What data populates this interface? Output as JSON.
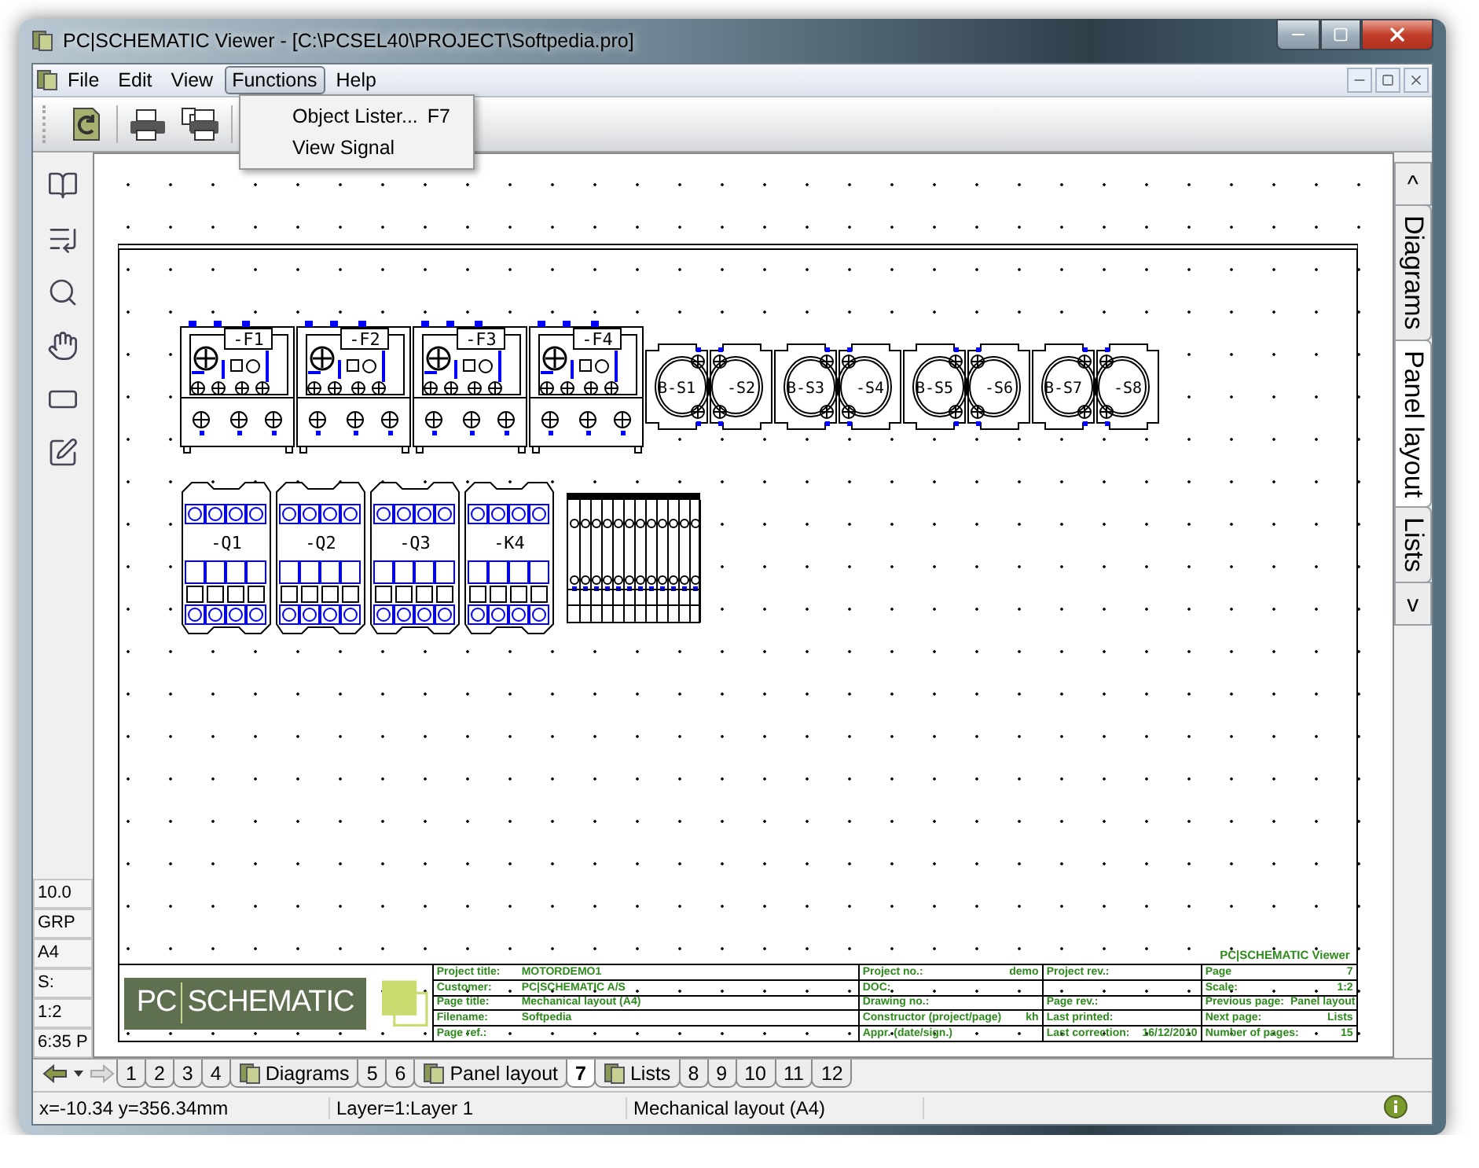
{
  "window": {
    "title": "PC|SCHEMATIC Viewer - [C:\\PCSEL40\\PROJECT\\Softpedia.pro]"
  },
  "menu": [
    {
      "label": "File",
      "selected": false
    },
    {
      "label": "Edit",
      "selected": false
    },
    {
      "label": "View",
      "selected": false
    },
    {
      "label": "Functions",
      "selected": true
    },
    {
      "label": "Help",
      "selected": false
    }
  ],
  "dropdown": [
    {
      "label": "Object Lister...",
      "shortcut": "F7"
    },
    {
      "label": "View Signal"
    }
  ],
  "left_status": [
    "10.0",
    "GRP",
    "A4",
    "S:",
    "1:2",
    "6:35 P"
  ],
  "canvas": {
    "row_1": [
      {
        "kind": "breaker",
        "label": "-F1"
      },
      {
        "kind": "breaker",
        "label": "-F2"
      },
      {
        "kind": "breaker",
        "label": "-F3"
      },
      {
        "kind": "breaker",
        "label": "-F4"
      },
      {
        "kind": "switch",
        "label": "B-S1"
      },
      {
        "kind": "switch",
        "label": "-S2"
      },
      {
        "kind": "switch",
        "label": "B-S3"
      },
      {
        "kind": "switch",
        "label": "-S4"
      },
      {
        "kind": "switch",
        "label": "B-S5"
      },
      {
        "kind": "switch",
        "label": "-S6"
      },
      {
        "kind": "switch",
        "label": "B-S7"
      },
      {
        "kind": "switch",
        "label": "-S8"
      }
    ],
    "row_2": [
      {
        "kind": "contactor",
        "label": "-Q1"
      },
      {
        "kind": "contactor",
        "label": "-Q2"
      },
      {
        "kind": "contactor",
        "label": "-Q3"
      },
      {
        "kind": "contactor",
        "label": "-K4"
      },
      {
        "kind": "terminal_strip"
      }
    ],
    "viewer_label": "PC|SCHEMATIC Viewer",
    "logo": {
      "left": "PC",
      "right": "SCHEMATIC"
    },
    "title_block": [
      [
        {
          "kind": "field",
          "label": "Project title:",
          "value": "MOTORDEMO1"
        },
        {
          "kind": "field",
          "label": "Customer:",
          "value": "PC|SCHEMATIC A/S"
        },
        {
          "kind": "field",
          "label": "Page title:",
          "value": "Mechanical layout (A4)"
        },
        {
          "kind": "field",
          "label": "Filename:",
          "value": "Softpedia"
        },
        {
          "kind": "field",
          "label": "Page ref.:"
        }
      ],
      [
        {
          "kind": "field",
          "label": "Project no.:",
          "value": "demo"
        },
        {
          "kind": "field",
          "label": "DOC:"
        },
        {
          "kind": "field",
          "label": "Drawing no.:"
        },
        {
          "kind": "field",
          "label": "Constructor (project/page)",
          "value": "kh"
        },
        {
          "kind": "field",
          "label": "Appr. (date/sign.)"
        }
      ],
      [
        {
          "kind": "field",
          "label": "Project rev.:"
        },
        {
          "kind": "blank"
        },
        {
          "kind": "field",
          "label": "Page rev.:"
        },
        {
          "kind": "field",
          "label": "Last printed:"
        },
        {
          "kind": "field",
          "label": "Last correction:",
          "value": "16/12/2010"
        }
      ],
      [
        {
          "kind": "field",
          "label": "Page",
          "value": "7"
        },
        {
          "kind": "field",
          "label": "Scale:",
          "value": "1:2"
        },
        {
          "kind": "field",
          "label": "Previous page:",
          "value": "Panel layout"
        },
        {
          "kind": "field",
          "label": "Next page:",
          "value": "Lists"
        },
        {
          "kind": "field",
          "label": "Number of pages:",
          "value": "15"
        }
      ]
    ]
  },
  "side_tabs": [
    {
      "kind": "arrow",
      "label": "^",
      "selected": false
    },
    {
      "kind": "tab",
      "label": "Diagrams",
      "selected": false
    },
    {
      "kind": "tab",
      "label": "Panel layout",
      "selected": true
    },
    {
      "kind": "tab",
      "label": "Lists",
      "selected": false
    },
    {
      "kind": "arrow",
      "label": "v",
      "selected": false
    }
  ],
  "page_tabs": [
    {
      "kind": "page",
      "label": "1",
      "selected": false
    },
    {
      "kind": "page",
      "label": "2",
      "selected": false
    },
    {
      "kind": "page",
      "label": "3",
      "selected": false
    },
    {
      "kind": "page",
      "label": "4",
      "selected": false
    },
    {
      "kind": "section",
      "label": "Diagrams",
      "selected": false
    },
    {
      "kind": "page",
      "label": "5",
      "selected": false
    },
    {
      "kind": "page",
      "label": "6",
      "selected": false
    },
    {
      "kind": "section",
      "label": "Panel layout",
      "selected": false
    },
    {
      "kind": "page",
      "label": "7",
      "selected": true
    },
    {
      "kind": "section",
      "label": "Lists",
      "selected": false
    },
    {
      "kind": "page",
      "label": "8",
      "selected": false
    },
    {
      "kind": "page",
      "label": "9",
      "selected": false
    },
    {
      "kind": "page",
      "label": "10",
      "selected": false
    },
    {
      "kind": "page",
      "label": "11",
      "selected": false
    },
    {
      "kind": "page",
      "label": "12",
      "selected": false
    }
  ],
  "status_bar": [
    "x=-10.34 y=356.34mm",
    "Layer=1:Layer 1",
    "Mechanical layout (A4)"
  ]
}
